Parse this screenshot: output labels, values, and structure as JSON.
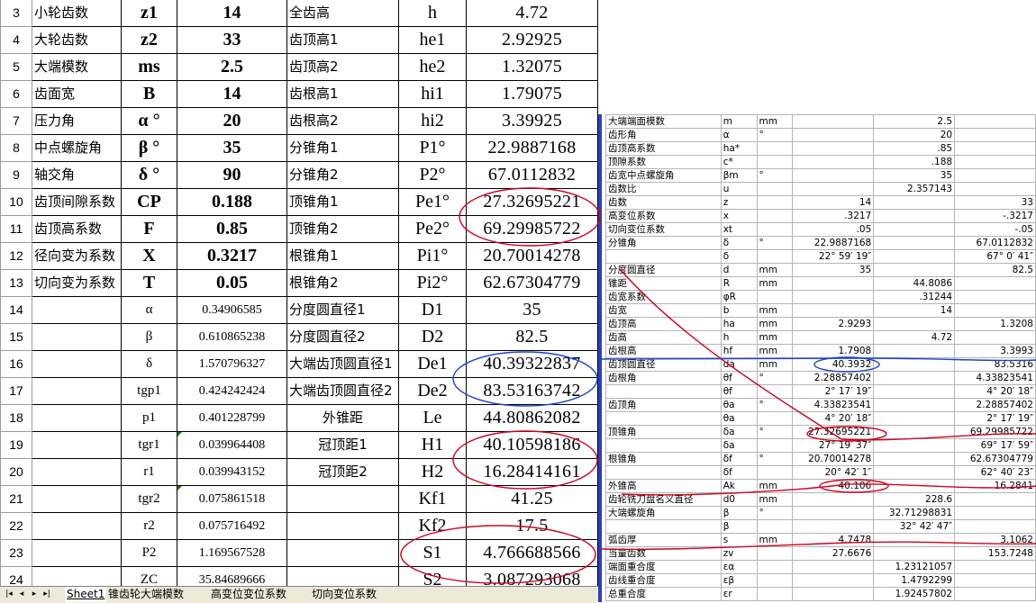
{
  "main_sheet": {
    "rows": [
      {
        "rn": "3",
        "c1": "小轮齿数",
        "c2": "z1",
        "c3": "14",
        "c4": "全齿高",
        "c5": "h",
        "c6": "4.72"
      },
      {
        "rn": "4",
        "c1": "大轮齿数",
        "c2": "z2",
        "c3": "33",
        "c4": "齿顶高1",
        "c5": "he1",
        "c6": "2.92925"
      },
      {
        "rn": "5",
        "c1": "大端模数",
        "c2": "ms",
        "c3": "2.5",
        "c4": "齿顶高2",
        "c5": "he2",
        "c6": "1.32075"
      },
      {
        "rn": "6",
        "c1": "齿面宽",
        "c2": "B",
        "c3": "14",
        "c4": "齿根高1",
        "c5": "hi1",
        "c6": "1.79075"
      },
      {
        "rn": "7",
        "c1": "压力角",
        "c2": "α °",
        "c3": "20",
        "c4": "齿根高2",
        "c5": "hi2",
        "c6": "3.39925"
      },
      {
        "rn": "8",
        "c1": "中点螺旋角",
        "c2": "β °",
        "c3": "35",
        "c4": "分锥角1",
        "c5": "P1°",
        "c6": "22.9887168"
      },
      {
        "rn": "9",
        "c1": "轴交角",
        "c2": "δ °",
        "c3": "90",
        "c4": "分锥角2",
        "c5": "P2°",
        "c6": "67.0112832"
      },
      {
        "rn": "10",
        "c1": "齿顶间隙系数",
        "c2": "CP",
        "c3": "0.188",
        "c4": "顶锥角1",
        "c5": "Pe1°",
        "c6": "27.32695221"
      },
      {
        "rn": "11",
        "c1": "齿顶高系数",
        "c2": "F",
        "c3": "0.85",
        "c4": "顶锥角2",
        "c5": "Pe2°",
        "c6": "69.29985722"
      },
      {
        "rn": "12",
        "c1": "径向变为系数",
        "c2": "X",
        "c3": "0.3217",
        "c4": "根锥角1",
        "c5": "Pi1°",
        "c6": "20.70014278"
      },
      {
        "rn": "13",
        "c1": "切向变为系数",
        "c2": "T",
        "c3": "0.05",
        "c4": "根锥角2",
        "c5": "Pi2°",
        "c6": "62.67304779"
      },
      {
        "rn": "14",
        "c1": "",
        "c2": "α",
        "c3": "0.34906585",
        "c4": "分度圆直径1",
        "c5": "D1",
        "c6": "35"
      },
      {
        "rn": "15",
        "c1": "",
        "c2": "β",
        "c3": "0.610865238",
        "c4": "分度圆直径2",
        "c5": "D2",
        "c6": "82.5"
      },
      {
        "rn": "16",
        "c1": "",
        "c2": "δ",
        "c3": "1.570796327",
        "c4": "大端齿顶圆直径1",
        "c5": "De1",
        "c6": "40.39322837"
      },
      {
        "rn": "17",
        "c1": "",
        "c2": "tgp1",
        "c3": "0.424242424",
        "c4": "大端齿顶圆直径2",
        "c5": "De2",
        "c6": "83.53163742"
      },
      {
        "rn": "18",
        "c1": "",
        "c2": "p1",
        "c3": "0.401228799",
        "c4": "外锥距",
        "c5": "Le",
        "c6": "44.80862082"
      },
      {
        "rn": "19",
        "c1": "",
        "c2": "tgr1",
        "c3": "0.039964408",
        "c4": "冠顶距1",
        "c5": "H1",
        "c6": "40.10598186"
      },
      {
        "rn": "20",
        "c1": "",
        "c2": "r1",
        "c3": "0.039943152",
        "c4": "冠顶距2",
        "c5": "H2",
        "c6": "16.28414161"
      },
      {
        "rn": "21",
        "c1": "",
        "c2": "tgr2",
        "c3": "0.075861518",
        "c4": "",
        "c5": "Kf1",
        "c6": "41.25"
      },
      {
        "rn": "22",
        "c1": "",
        "c2": "r2",
        "c3": "0.075716492",
        "c4": "",
        "c5": "Kf2",
        "c6": "17.5"
      },
      {
        "rn": "23",
        "c1": "",
        "c2": "P2",
        "c3": "1.169567528",
        "c4": "",
        "c5": "S1",
        "c6": "4.766688566"
      },
      {
        "rn": "24",
        "c1": "",
        "c2": "ZC",
        "c3": "35.84689666",
        "c4": "",
        "c5": "S2",
        "c6": "3.087293068"
      },
      {
        "rn": "",
        "c1": "",
        "c2": "",
        "c3": "",
        "c4": "",
        "c5": "",
        "c6": ""
      }
    ]
  },
  "right_sheet": {
    "rows": [
      {
        "a": "大端端面模数",
        "b": "m",
        "c": "mm",
        "d": "",
        "e": "2.5",
        "f": ""
      },
      {
        "a": "齿形角",
        "b": "α",
        "c": "°",
        "d": "",
        "e": "20",
        "f": ""
      },
      {
        "a": "齿顶高系数",
        "b": "ha*",
        "c": "",
        "d": "",
        ".e": "",
        "e": ".85",
        "f": ""
      },
      {
        "a": "顶隙系数",
        "b": "c*",
        "c": "",
        "d": "",
        "e": ".188",
        "f": ""
      },
      {
        "a": "齿宽中点螺旋角",
        "b": "βm",
        "c": "°",
        "d": "",
        "e": "35",
        "f": ""
      },
      {
        "a": "齿数比",
        "b": "u",
        "c": "",
        "d": "",
        "e": "2.357143",
        "f": ""
      },
      {
        "a": "齿数",
        "b": "z",
        "c": "",
        "d": "14",
        "e": "",
        "f": "33"
      },
      {
        "a": "高变位系数",
        "b": "x",
        "c": "",
        "d": ".3217",
        "e": "",
        "f": "-.3217"
      },
      {
        "a": "切向变位系数",
        "b": "xt",
        "c": "",
        "d": ".05",
        "e": "",
        "f": "-.05"
      },
      {
        "a": "分锥角",
        "b": "δ",
        "c": "°",
        "d": "22.9887168",
        "e": "",
        "f": "67.0112832"
      },
      {
        "a": "",
        "b": "δ",
        "c": "",
        "d": "22°  59′ 19″",
        "e": "",
        "f": "67°  0′ 41″"
      },
      {
        "a": "分度圆直径",
        "b": "d",
        "c": "mm",
        "d": "35",
        "e": "",
        "f": "82.5"
      },
      {
        "a": "锥距",
        "b": "R",
        "c": "mm",
        "d": "",
        "e": "44.8086",
        "f": ""
      },
      {
        "a": "齿宽系数",
        "b": "φR",
        "c": "",
        "d": "",
        "e": ".31244",
        "f": ""
      },
      {
        "a": "齿宽",
        "b": "b",
        "c": "mm",
        "d": "",
        "e": "14",
        "f": ""
      },
      {
        "a": "齿顶高",
        "b": "ha",
        "c": "mm",
        "d": "2.9293",
        "e": "",
        "f": "1.3208"
      },
      {
        "a": "齿高",
        "b": "h",
        "c": "mm",
        "d": "",
        "e": "4.72",
        "f": ""
      },
      {
        "a": "齿根高",
        "b": "hf",
        "c": "mm",
        "d": "1.7908",
        "e": "",
        "f": "3.3993"
      },
      {
        "a": "齿顶圆直径",
        "b": "da",
        "c": "mm",
        "d": "40.3932",
        "e": "",
        "f": "83.5316"
      },
      {
        "a": "齿根角",
        "b": "θf",
        "c": "°",
        "d": "2.28857402",
        "e": "",
        "f": "4.33823541"
      },
      {
        "a": "",
        "b": "θf",
        "c": "",
        "d": "2°  17′ 19″",
        "e": "",
        "f": "4°  20′ 18″"
      },
      {
        "a": "齿顶角",
        "b": "θa",
        "c": "°",
        "d": "4.33823541",
        "e": "",
        "f": "2.28857402"
      },
      {
        "a": "",
        "b": "θa",
        "c": "",
        "d": "4°  20′ 18″",
        "e": "",
        "f": "2°  17′ 19″"
      },
      {
        "a": "顶锥角",
        "b": "δa",
        "c": "°",
        "d": "27.32695221",
        "e": "",
        "f": "69.29985722"
      },
      {
        "a": "",
        "b": "δa",
        "c": "",
        "d": "27°  19′ 37″",
        "e": "",
        "f": "69°  17′ 59″"
      },
      {
        "a": "根锥角",
        "b": "δf",
        "c": "°",
        "d": "20.70014278",
        "e": "",
        "f": "62.67304779"
      },
      {
        "a": "",
        "b": "δf",
        "c": "",
        "d": "20°  42′ 1″",
        "e": "",
        "f": "62°  40′ 23″"
      },
      {
        "a": "外锥高",
        "b": "Ak",
        "c": "mm",
        "d": "40.106",
        "e": "",
        "f": "16.2841"
      },
      {
        "a": "齿轮铣刀盘名义直径",
        "b": "d0",
        "c": "mm",
        "d": "",
        "e": "228.6",
        "f": ""
      },
      {
        "a": "大端螺旋角",
        "b": "β",
        "c": "°",
        "d": "",
        "e": "32.71298831",
        "f": ""
      },
      {
        "a": "",
        "b": "β",
        "c": "",
        "d": "",
        "e": "32°  42′ 47″",
        "f": ""
      },
      {
        "a": "弧齿厚",
        "b": "s",
        "c": "mm",
        "d": "4.7478",
        "e": "",
        "f": "3.1062"
      },
      {
        "a": "当量齿数",
        "b": "zv",
        "c": "",
        "d": "27.6676",
        "e": "",
        "f": "153.7248"
      },
      {
        "a": "端面重合度",
        "b": "εα",
        "c": "",
        "d": "",
        "e": "1.23121057",
        "f": ""
      },
      {
        "a": "齿线重合度",
        "b": "εβ",
        "c": "",
        "d": "",
        "e": "1.4792299",
        "f": ""
      },
      {
        "a": "总重合度",
        "b": "εr",
        "c": "",
        "d": "",
        "e": "1.92457802",
        "f": ""
      }
    ]
  },
  "tabs": {
    "items": [
      "Sheet1",
      "锥齿轮大端模数",
      "高变位变位系数",
      "切向变位系数"
    ],
    "active": "Sheet1",
    "nav": [
      "|◂",
      "◂",
      "▸",
      "▸|"
    ]
  },
  "colors": {
    "annotation_red": "#d0021b",
    "annotation_blue": "#1f3fd0",
    "right_border": "#2a3fbf"
  }
}
